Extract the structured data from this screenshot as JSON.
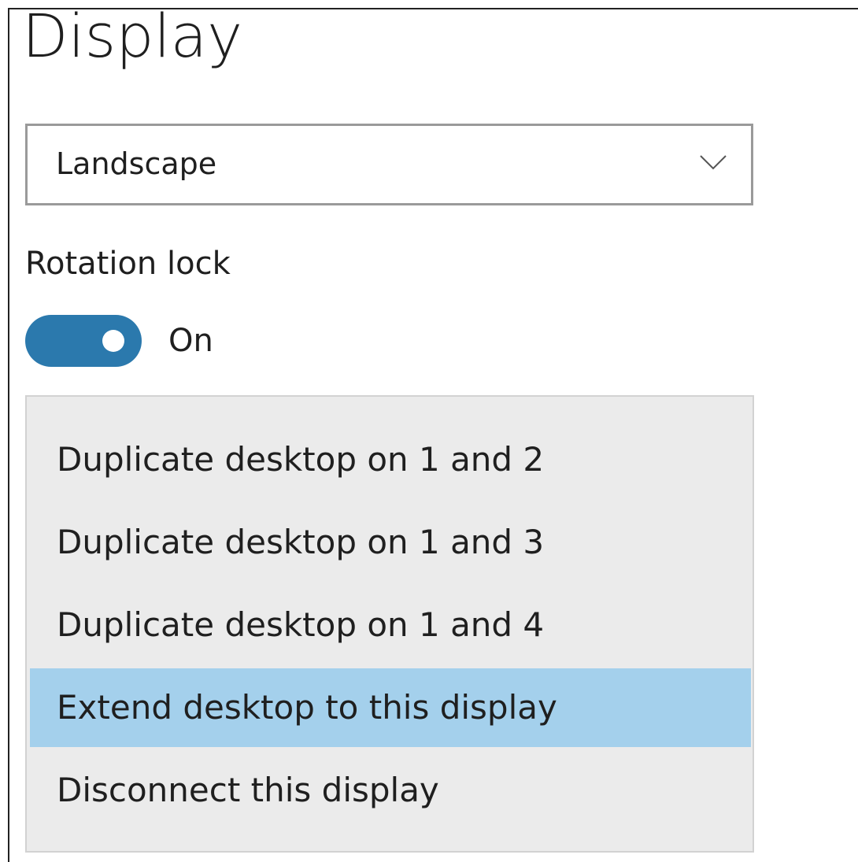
{
  "page_title": "Display",
  "orientation": {
    "selected": "Landscape",
    "icon": "chevron-down-icon"
  },
  "rotation_lock": {
    "label": "Rotation lock",
    "state_label": "On",
    "enabled": true,
    "accent_color": "#2b79ad"
  },
  "display_menu": {
    "selected_index": 3,
    "highlight_color": "#a4d0ec",
    "items": [
      {
        "label": "Duplicate desktop on 1 and 2"
      },
      {
        "label": "Duplicate desktop on 1 and 3"
      },
      {
        "label": "Duplicate desktop on 1 and 4"
      },
      {
        "label": "Extend desktop to this display"
      },
      {
        "label": "Disconnect this display"
      }
    ]
  }
}
